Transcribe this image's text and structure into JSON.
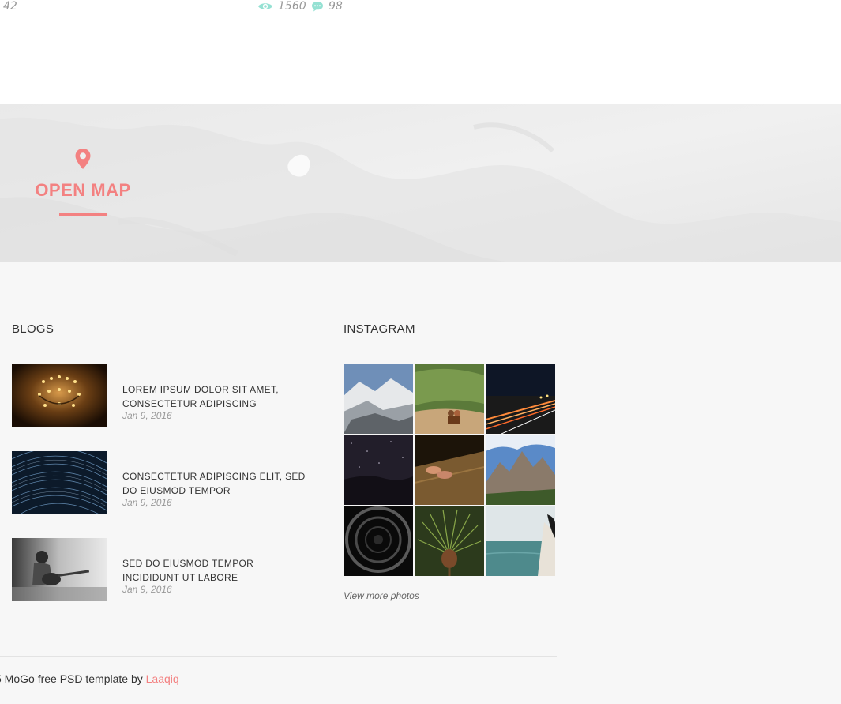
{
  "post_stats": {
    "left_count": "42",
    "views": "1560",
    "comments": "98",
    "views_icon": "eye-icon",
    "comments_icon": "speech-bubble-icon",
    "accent_color": "#95e1d3"
  },
  "map": {
    "label": "OPEN MAP",
    "icon": "map-pin-icon",
    "accent_color": "#f38181"
  },
  "blogs": {
    "title": "BLOGS",
    "items": [
      {
        "title": "LOREM IPSUM DOLOR SIT AMET, CONSECTETUR ADIPISCING",
        "date": "Jan 9, 2016",
        "thumb": "chandelier candles"
      },
      {
        "title": "CONSECTETUR ADIPISCING ELIT, SED DO EIUSMOD TEMPOR",
        "date": "Jan 9, 2016",
        "thumb": "star trails night sky"
      },
      {
        "title": "SED DO EIUSMOD TEMPOR INCIDIDUNT UT LABORE",
        "date": "Jan 9, 2016",
        "thumb": "man playing guitar"
      }
    ]
  },
  "instagram": {
    "title": "INSTAGRAM",
    "photos": [
      "snowy mountain",
      "couple on hill",
      "night highway",
      "starry sky",
      "feet on wood",
      "rocky peaks",
      "tunnel",
      "pine cone",
      "sea view"
    ],
    "view_more": "View more photos"
  },
  "footer": {
    "copyright_prefix": "5 MoGo free PSD template by ",
    "author": "Laaqiq",
    "accent_color": "#f38181"
  }
}
